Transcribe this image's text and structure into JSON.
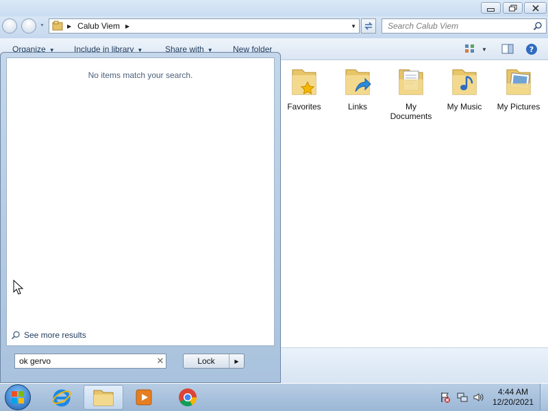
{
  "window": {
    "address_path": "Calub Viem",
    "search_placeholder": "Search Calub Viem"
  },
  "toolbar": {
    "organize": "Organize",
    "include_in_library": "Include in library",
    "share_with": "Share with",
    "new_folder": "New folder"
  },
  "folders": [
    {
      "label": "Favorites",
      "icon": "favorites-folder-icon"
    },
    {
      "label": "Links",
      "icon": "links-folder-icon"
    },
    {
      "label": "My Documents",
      "icon": "documents-folder-icon"
    },
    {
      "label": "My Music",
      "icon": "music-folder-icon"
    },
    {
      "label": "My Pictures",
      "icon": "pictures-folder-icon"
    }
  ],
  "start_menu": {
    "no_match_text": "No items match your search.",
    "see_more_results": "See more results",
    "search_value": "ok gervo",
    "lock_label": "Lock"
  },
  "taskbar": {
    "time": "4:44 AM",
    "date": "12/20/2021"
  }
}
